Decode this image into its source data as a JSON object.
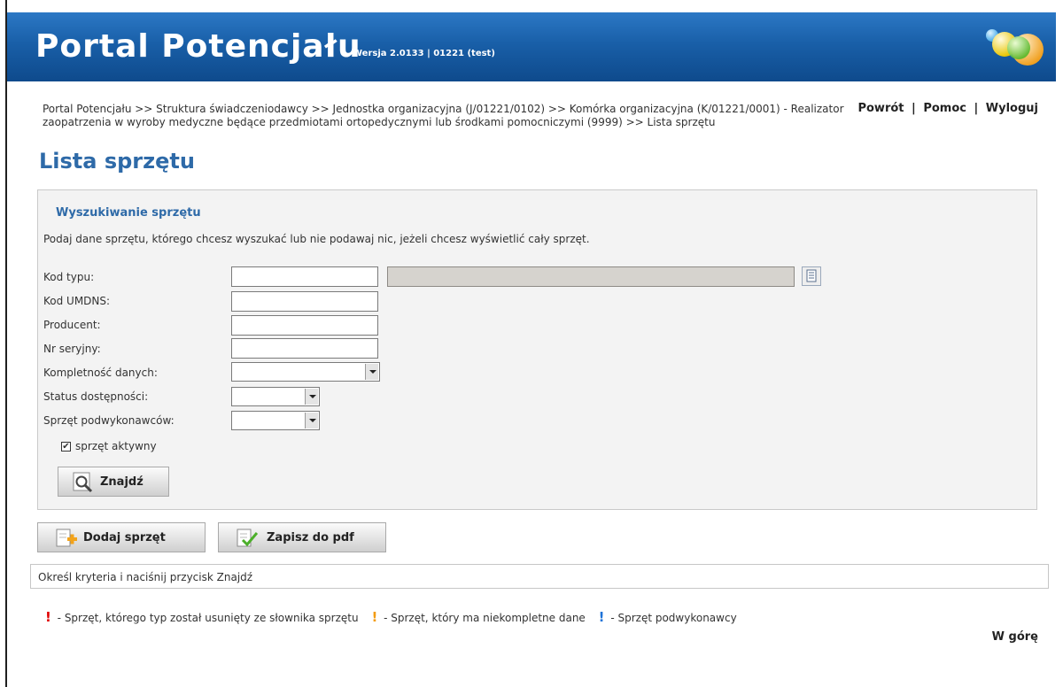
{
  "header": {
    "title": "Portal Potencjału",
    "version": "Wersja 2.0133 | 01221 (test)"
  },
  "breadcrumb": {
    "text": "Portal Potencjału >> Struktura świadczeniodawcy >> Jednostka organizacyjna (J/01221/0102) >> Komórka organizacyjna (K/01221/0001) - Realizator zaopatrzenia w wyroby medyczne będące przedmiotami ortopedycznymi lub środkami pomocniczymi (9999) >> Lista sprzętu"
  },
  "toplinks": {
    "back": "Powrót",
    "help": "Pomoc",
    "logout": "Wyloguj",
    "sep": "|"
  },
  "page_title": "Lista sprzętu",
  "search": {
    "title": "Wyszukiwanie sprzętu",
    "description": "Podaj dane sprzętu, którego chcesz wyszukać lub nie podawaj nic, jeżeli chcesz wyświetlić cały sprzęt.",
    "fields": {
      "type_code": {
        "label": "Kod typu:",
        "value": "",
        "name_value": ""
      },
      "umdns_code": {
        "label": "Kod UMDNS:",
        "value": ""
      },
      "producer": {
        "label": "Producent:",
        "value": ""
      },
      "serial": {
        "label": "Nr seryjny:",
        "value": ""
      },
      "completeness": {
        "label": "Kompletność danych:",
        "selected": ""
      },
      "availability": {
        "label": "Status dostępności:",
        "selected": ""
      },
      "subcontractor": {
        "label": "Sprzęt podwykonawców:",
        "selected": ""
      }
    },
    "active_checkbox": {
      "label": "sprzęt aktywny",
      "checked": true,
      "mark": "✔"
    },
    "find_button": "Znajdź"
  },
  "actions": {
    "add_button": "Dodaj sprzęt",
    "pdf_button": "Zapisz do pdf"
  },
  "info": "Określ kryteria i naciśnij przycisk Znajdź",
  "legend": {
    "mark": "!",
    "removed": "- Sprzęt, którego typ został usunięty ze słownika sprzętu",
    "removed_color": "#e00000",
    "incomplete": "- Sprzęt, który ma niekompletne dane",
    "incomplete_color": "#f39c12",
    "subcontractor": "- Sprzęt podwykonawcy",
    "subcontractor_color": "#1e73d8"
  },
  "top_link": "W górę",
  "colors": {
    "header": "#195fa8",
    "title": "#2e6aa8"
  }
}
